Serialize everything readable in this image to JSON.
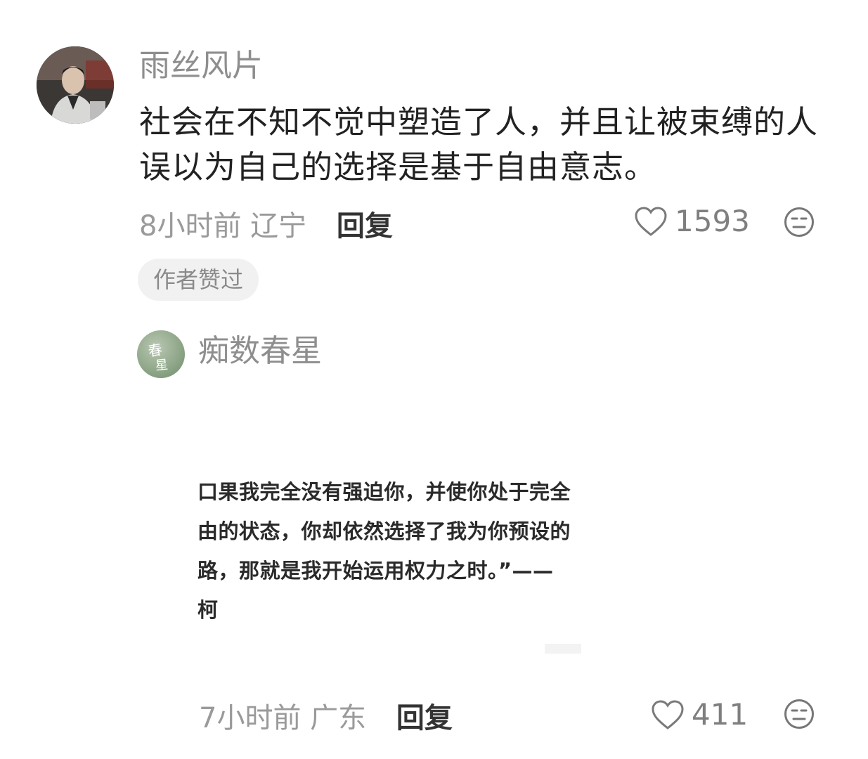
{
  "comments": [
    {
      "username": "雨丝风片",
      "text": "社会在不知不觉中塑造了人，并且让被束缚的人误以为自己的选择是基于自由意志。",
      "time": "8小时前",
      "location": "辽宁",
      "reply_label": "回复",
      "likes": "1593",
      "badge": "作者赞过",
      "icons": {
        "like": "heart-outline-icon",
        "reaction": "neutral-face-icon"
      }
    },
    {
      "username": "痴数春星",
      "avatar_text": "春星",
      "image_lines": [
        "口果我完全没有强迫你，并使你处于完全",
        "由的状态，你却依然选择了我为你预设的",
        "路，那就是我开始运用权力之时。”——",
        "柯"
      ],
      "time": "7小时前",
      "location": "广东",
      "reply_label": "回复",
      "likes": "411",
      "icons": {
        "like": "heart-outline-icon",
        "reaction": "neutral-face-icon"
      }
    }
  ],
  "colors": {
    "text": "#222222",
    "meta": "#9a9a9a",
    "username": "#8e8e8e",
    "badge_bg": "#f1f1f1"
  }
}
